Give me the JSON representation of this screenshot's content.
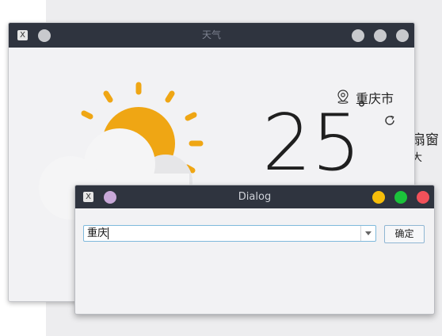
{
  "main_window": {
    "title": "天气",
    "app_icon_glyph": "X",
    "city": "重庆市",
    "temperature": "25",
    "degree_symbol": "°",
    "icons": [
      "location-pin-icon",
      "refresh-icon",
      "sun-behind-cloud-icon"
    ],
    "colors": {
      "sun": "#efa614",
      "cloud": "#f5f5f6",
      "titlebar": "#2f343f"
    }
  },
  "background_window": {
    "text_1": "扇窗",
    "text_2": "大"
  },
  "dialog": {
    "title": "Dialog",
    "app_icon_glyph": "X",
    "combo_value": "重庆",
    "ok_label": "确定",
    "colors": {
      "minimize": "#f6bd0a",
      "maximize": "#1bc33b",
      "close": "#f2515a",
      "menu": "#c8a8d8"
    }
  }
}
